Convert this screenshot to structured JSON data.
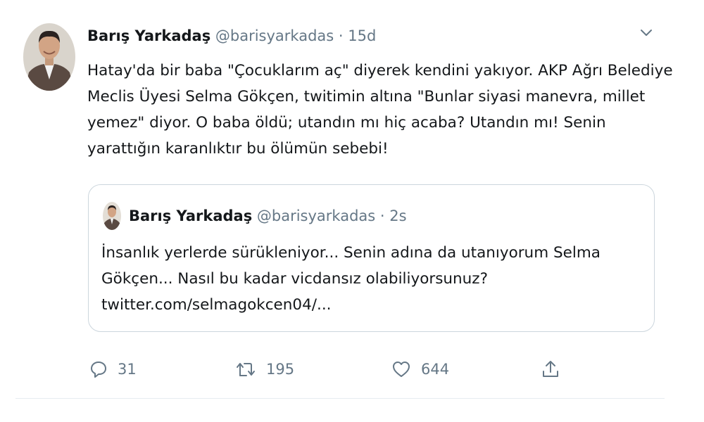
{
  "tweet": {
    "author_name": "Barış Yarkadaş",
    "author_handle": "@barisyarkadas",
    "separator": "·",
    "time": "15d",
    "text_lines": [
      "Hatay'da bir baba \"Çocuklarım aç\" diyerek kendini yakıyor. AKP Ağrı Belediye",
      "Meclis Üyesi Selma Gökçen, twitimin altına \"Bunlar siyasi manevra, millet",
      "yemez\" diyor. O baba öldü; utandın mı hiç acaba? Utandın mı! Senin",
      "yarattığın karanlıktır bu ölümün sebebi!"
    ]
  },
  "quoted_tweet": {
    "author_name": "Barış Yarkadaş",
    "author_handle": "@barisyarkadas",
    "separator": "·",
    "time": "2s",
    "text_lines": [
      "İnsanlık yerlerde sürükleniyor... Senin adına da utanıyorum Selma",
      "Gökçen... Nasıl bu kadar vicdansız olabiliyorsunuz?",
      "twitter.com/selmagokcen04/..."
    ]
  },
  "actions": {
    "reply_count": "31",
    "retweet_count": "195",
    "like_count": "644"
  },
  "icons": {
    "caret": "chevron-down-icon",
    "reply": "reply-icon",
    "retweet": "retweet-icon",
    "like": "heart-icon",
    "share": "share-icon"
  },
  "colors": {
    "text": "#14171a",
    "secondary": "#657786",
    "border": "#ccd6dd"
  }
}
